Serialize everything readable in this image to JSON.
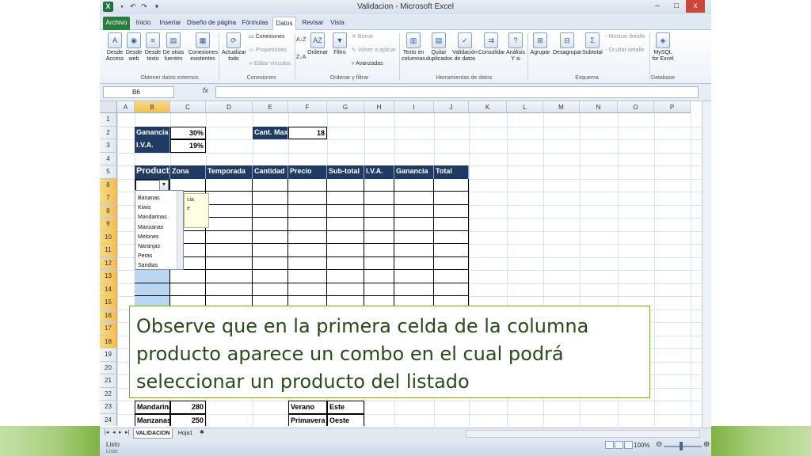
{
  "window": {
    "title": "Validacion - Microsoft Excel",
    "minimize": "–",
    "maximize": "□",
    "close": "x",
    "help": "?"
  },
  "tabs": [
    "Archivo",
    "Inicio",
    "Insertar",
    "Diseño de página",
    "Fórmulas",
    "Datos",
    "Revisar",
    "Vista"
  ],
  "ribbon": {
    "groups": [
      {
        "label": "Obtener datos externos"
      },
      {
        "label": "Conexiones"
      },
      {
        "label": "Ordenar y filtrar"
      },
      {
        "label": "Herramientas de datos"
      },
      {
        "label": "Esquema"
      },
      {
        "label": "Database"
      }
    ],
    "buttons": {
      "desde_access": "Desde Access",
      "desde_web": "Desde web",
      "desde_texto": "Desde texto",
      "desde_otras": "De otras fuentes",
      "conexiones_existentes": "Conexiones existentes",
      "actualizar_todo": "Actualizar todo",
      "conexiones": "Conexiones",
      "propiedades": "Propiedades",
      "editar_vinculos": "Editar vínculos",
      "ordenar": "Ordenar",
      "filtro": "Filtro",
      "borrar": "Borrar",
      "volver_aplicar": "Volver a aplicar",
      "avanzadas": "Avanzadas",
      "texto_columnas": "Texto en columnas",
      "quitar_duplicados": "Quitar duplicados",
      "validacion_datos": "Validación de datos",
      "consolidar": "Consolidar",
      "analisis_ysi": "Análisis Y si",
      "agrupar": "Agrupar",
      "desagrupar": "Desagrupar",
      "subtotal": "Subtotal",
      "mostrar_detalle": "Mostrar detalle",
      "ocultar_detalle": "Ocultar detalle",
      "mysql": "MySQL for Excel"
    }
  },
  "formula_bar": {
    "name_box": "B6",
    "fx": "fx",
    "value": ""
  },
  "columns": [
    "A",
    "B",
    "C",
    "D",
    "E",
    "F",
    "G",
    "H",
    "I",
    "J",
    "K",
    "L",
    "M",
    "N",
    "O",
    "P"
  ],
  "rows": [
    "1",
    "2",
    "3",
    "4",
    "5",
    "6",
    "7",
    "8",
    "9",
    "10",
    "11",
    "12",
    "13",
    "14",
    "15",
    "16",
    "17",
    "18",
    "19",
    "20",
    "21",
    "22",
    "23",
    "24"
  ],
  "cells": {
    "b2": "Ganancia",
    "c2": "30%",
    "b3": "I.V.A.",
    "c3": "19%",
    "e2": "Cant. Max",
    "f2": "18",
    "b23": "Mandarinas",
    "c23": "280",
    "b24": "Manzanas",
    "c24": "250",
    "f23": "Verano",
    "g23": "Este",
    "f24": "Primavera",
    "g24": "Oeste"
  },
  "table_headers": [
    "Productos",
    "Zona",
    "Temporada",
    "Cantidad",
    "Precio",
    "Sub-total",
    "I.V.A.",
    "Ganancia",
    "Total"
  ],
  "dropdown": {
    "items": [
      "Bananas",
      "Kiwis",
      "Mandarinas",
      "Manzanas",
      "Melones",
      "Naranjas",
      "Peras",
      "Sandias"
    ]
  },
  "tooltip_lines": [
    "cia",
    "e"
  ],
  "sheet_tabs": [
    "VALIDACION",
    "Hoja1"
  ],
  "status": {
    "ready": "Listo",
    "ready_2": "Listo",
    "zoom": "100%"
  },
  "callout": "Observe que en la primera celda de la columna producto aparece un combo en el cual podrá seleccionar un producto del listado"
}
